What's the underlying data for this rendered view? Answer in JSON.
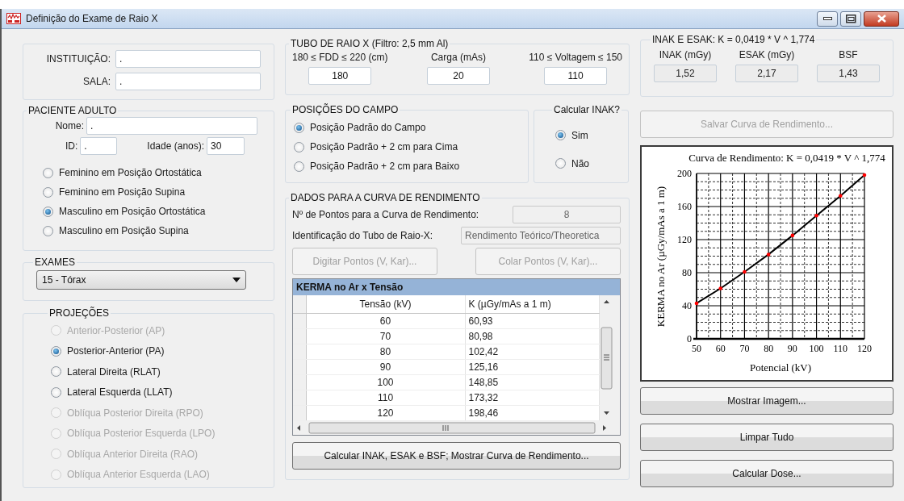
{
  "window": {
    "title": "Definição do Exame de Raio X"
  },
  "institution": {
    "fields": [
      {
        "label": "INSTITUIÇÃO:",
        "value": "."
      },
      {
        "label": "SALA:",
        "value": "."
      }
    ]
  },
  "patient": {
    "title": "PACIENTE ADULTO",
    "name": {
      "label": "Nome:",
      "value": "."
    },
    "id": {
      "label": "ID:",
      "value": "."
    },
    "age": {
      "label": "Idade (anos):",
      "value": "30"
    },
    "options": [
      {
        "label": "Feminino em Posição Ortostática",
        "selected": false
      },
      {
        "label": "Feminino em Posição Supina",
        "selected": false
      },
      {
        "label": "Masculino em Posição Ortostática",
        "selected": true
      },
      {
        "label": "Masculino em Posição Supina",
        "selected": false
      }
    ]
  },
  "exams": {
    "title": "EXAMES",
    "selected_value": "15 - Tórax"
  },
  "projections": {
    "title": "PROJEÇÕES",
    "options": [
      {
        "label": "Anterior-Posterior (AP)",
        "selected": false,
        "disabled": true
      },
      {
        "label": "Posterior-Anterior (PA)",
        "selected": true,
        "disabled": false
      },
      {
        "label": "Lateral Direita (RLAT)",
        "selected": false,
        "disabled": false
      },
      {
        "label": "Lateral Esquerda (LLAT)",
        "selected": false,
        "disabled": false
      },
      {
        "label": "Oblíqua Posterior Direita (RPO)",
        "selected": false,
        "disabled": true
      },
      {
        "label": "Oblíqua Posterior Esquerda (LPO)",
        "selected": false,
        "disabled": true
      },
      {
        "label": "Oblíqua Anterior Direita (RAO)",
        "selected": false,
        "disabled": true
      },
      {
        "label": "Oblíqua Anterior Esquerda (LAO)",
        "selected": false,
        "disabled": true
      }
    ]
  },
  "tube": {
    "title": "TUBO DE RAIO X (Filtro: 2,5 mm Al)",
    "fields": [
      {
        "label": "180 ≤ FDD ≤ 220 (cm)",
        "value": "180"
      },
      {
        "label": "Carga (mAs)",
        "value": "20"
      },
      {
        "label": "110 ≤ Voltagem ≤ 150",
        "value": "110"
      }
    ]
  },
  "field_positions": {
    "title": "POSIÇÕES DO CAMPO",
    "options": [
      {
        "label": "Posição Padrão do Campo",
        "selected": true
      },
      {
        "label": "Posição Padrão + 2 cm para Cima",
        "selected": false
      },
      {
        "label": "Posição Padrão + 2 cm para Baixo",
        "selected": false
      }
    ]
  },
  "calc_inak": {
    "title": "Calcular INAK?",
    "options": [
      {
        "label": "Sim",
        "selected": true
      },
      {
        "label": "Não",
        "selected": false
      }
    ]
  },
  "curve_data": {
    "title": "DADOS PARA A CURVA DE RENDIMENTO",
    "fields": [
      {
        "label": "Nº de Pontos para a Curva de Rendimento:",
        "value": "8"
      },
      {
        "label": "Identificação do Tubo de Raio-X:",
        "value": "Rendimento Teórico/Theoretica"
      }
    ],
    "buttons": [
      {
        "label": "Digitar Pontos (V, Kar)...",
        "disabled": true
      },
      {
        "label": "Colar Pontos (V, Kar)...",
        "disabled": true
      }
    ],
    "table": {
      "title": "KERMA no Ar x Tensão",
      "columns": [
        "Tensão (kV)",
        "K (µGy/mAs a 1 m)"
      ],
      "rows": [
        [
          "60",
          "60,93"
        ],
        [
          "70",
          "80,98"
        ],
        [
          "80",
          "102,42"
        ],
        [
          "90",
          "125,16"
        ],
        [
          "100",
          "148,85"
        ],
        [
          "110",
          "173,32"
        ],
        [
          "120",
          "198,46"
        ]
      ]
    },
    "calculate_button": {
      "label": "Calcular INAK, ESAK e BSF; Mostrar Curva de Rendimento...",
      "disabled": false
    }
  },
  "results": {
    "title": "INAK E ESAK: K = 0,0419 * V ^ 1,774",
    "fields": [
      {
        "label": "INAK (mGy)",
        "value": "1,52"
      },
      {
        "label": "ESAK (mGy)",
        "value": "2,17"
      },
      {
        "label": "BSF",
        "value": "1,43"
      }
    ]
  },
  "save_curve_button": {
    "label": "Salvar Curva de Rendimento...",
    "disabled": true
  },
  "chart": {
    "chart_data": {
      "type": "line",
      "title": "Curva de Rendimento: K = 0,0419 * V ^ 1,774",
      "xlabel": "Potencial (kV)",
      "ylabel": "KERMA no Ar (µGy/mAs a 1 m)",
      "x": [
        50,
        60,
        70,
        80,
        90,
        100,
        110,
        120
      ],
      "series": [
        {
          "color": "#000000",
          "values": [
            43,
            61,
            81,
            102,
            125,
            149,
            173,
            198
          ]
        }
      ],
      "grid": true,
      "xlim": [
        50,
        120
      ],
      "ylim": [
        0,
        200
      ],
      "xticks": [
        50,
        60,
        70,
        80,
        90,
        100,
        110,
        120
      ],
      "yticks": [
        0,
        40,
        80,
        120,
        160,
        200
      ]
    }
  },
  "actions": [
    {
      "label": "Mostrar Imagem...",
      "disabled": false
    },
    {
      "label": "Limpar Tudo",
      "disabled": false
    },
    {
      "label": "Calcular Dose...",
      "disabled": false
    }
  ]
}
